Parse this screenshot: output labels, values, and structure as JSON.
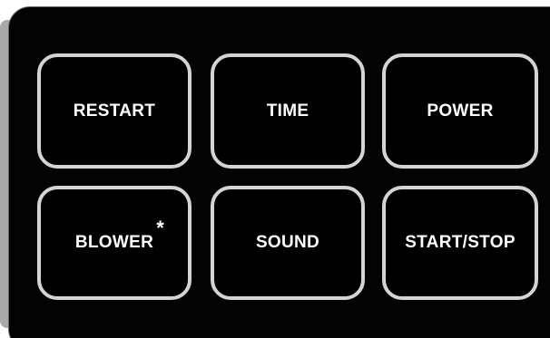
{
  "colors": {
    "panel_background": "#030303",
    "key_border": "#d4d4d4",
    "key_text": "#ffffff",
    "side_bezel": "#a9a9ab"
  },
  "keys": {
    "restart": "RESTART",
    "time": "TIME",
    "power": "POWER",
    "blower": "BLOWER",
    "blower_note": "*",
    "sound": "SOUND",
    "start_stop": "START/STOP"
  }
}
